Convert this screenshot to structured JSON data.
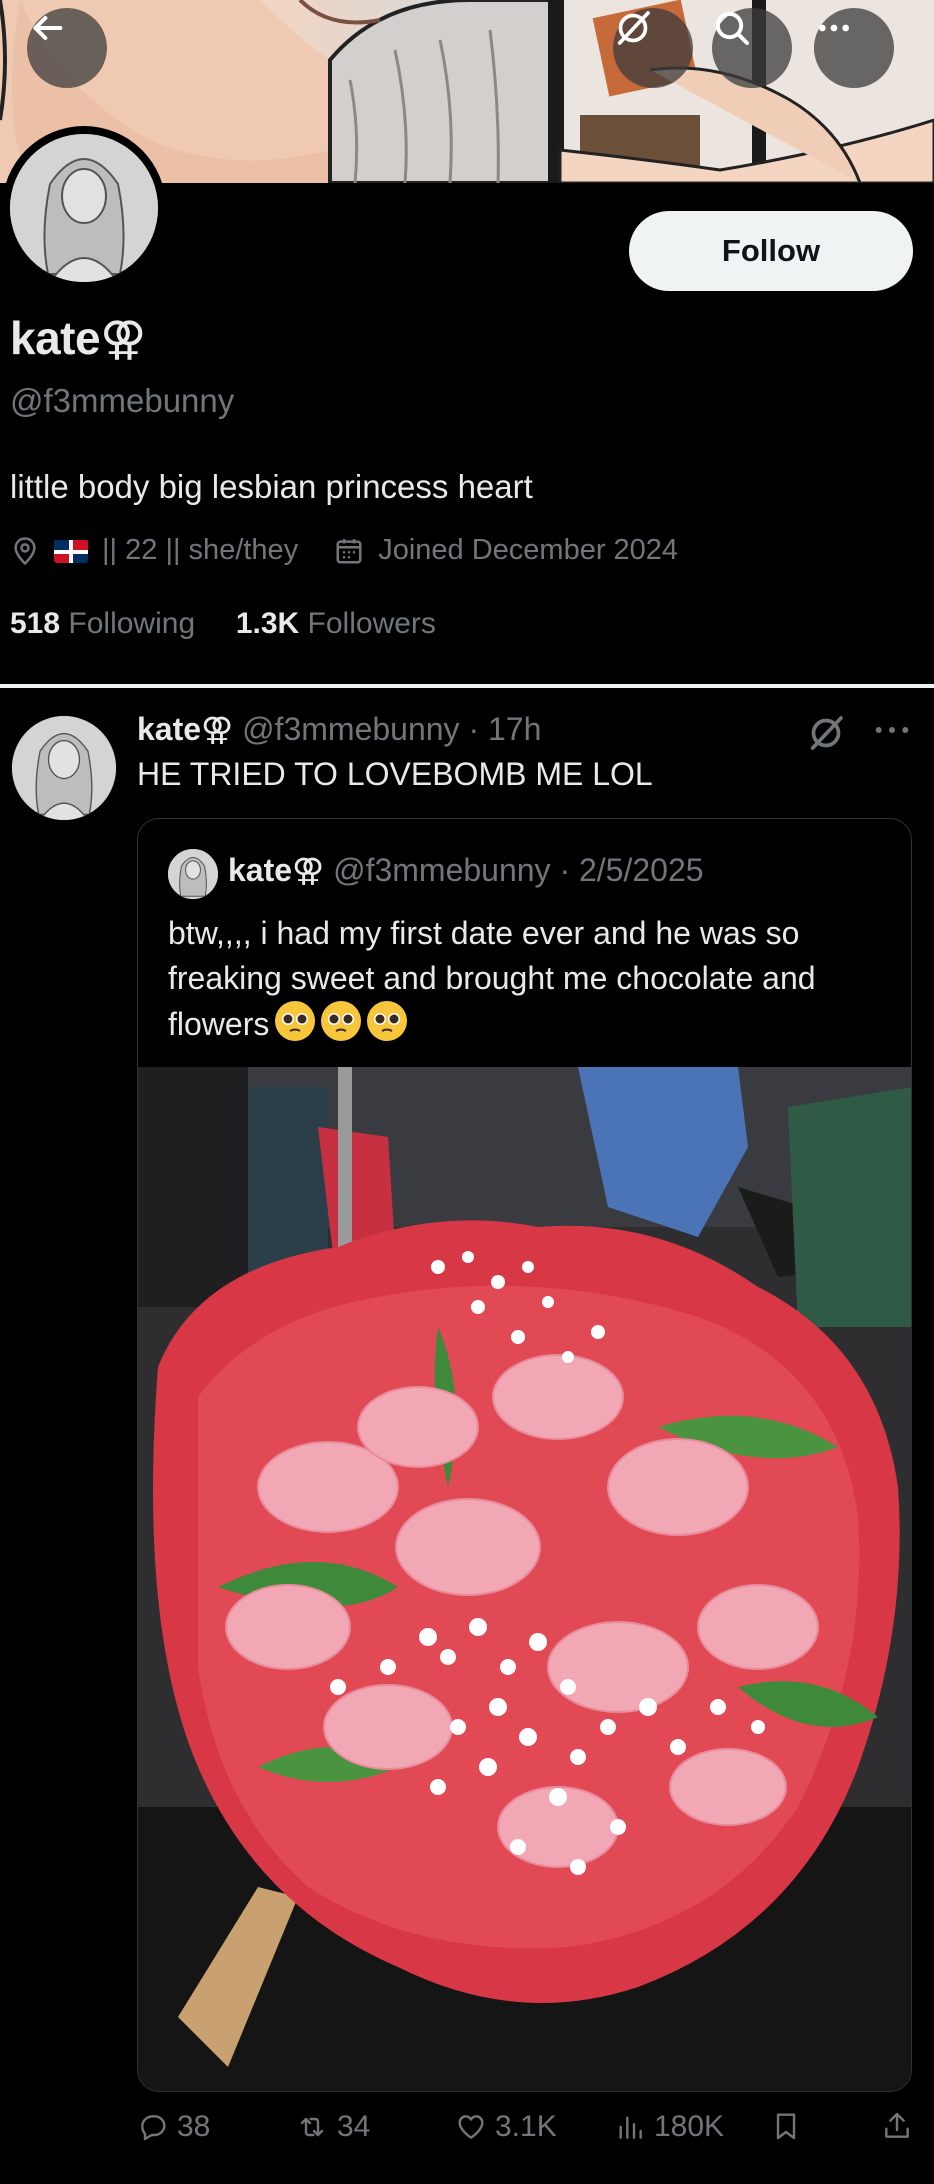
{
  "header": {
    "back_icon": "arrow-left-icon",
    "grok_icon": "grok-icon",
    "search_icon": "search-icon",
    "more_icon": "more-horizontal-icon"
  },
  "profile": {
    "display_name": "kate⚢",
    "handle": "@f3mmebunny",
    "bio": "little body big lesbian princess heart",
    "location_text": "|| 22 || she/they",
    "joined": "Joined December 2024",
    "following_count": "518",
    "following_label": "Following",
    "followers_count": "1.3K",
    "followers_label": "Followers",
    "follow_label": "Follow"
  },
  "tweet": {
    "author_name": "kate⚢",
    "author_handle": "@f3mmebunny",
    "time": "· 17h",
    "text": "HE TRIED TO LOVEBOMB ME LOL",
    "quote": {
      "author_name": "kate⚢",
      "author_handle": "@f3mmebunny",
      "date": "· 2/5/2025",
      "text": "btw,,,, i had my first date ever and he was so freaking sweet and brought me chocolate and flowers"
    },
    "actions": {
      "replies": "38",
      "reposts": "34",
      "likes": "3.1K",
      "views": "180K"
    }
  },
  "colors": {
    "background": "#000000",
    "text_primary": "#e7e9ea",
    "text_secondary": "#71767b",
    "follow_bg": "#eff3f4"
  }
}
